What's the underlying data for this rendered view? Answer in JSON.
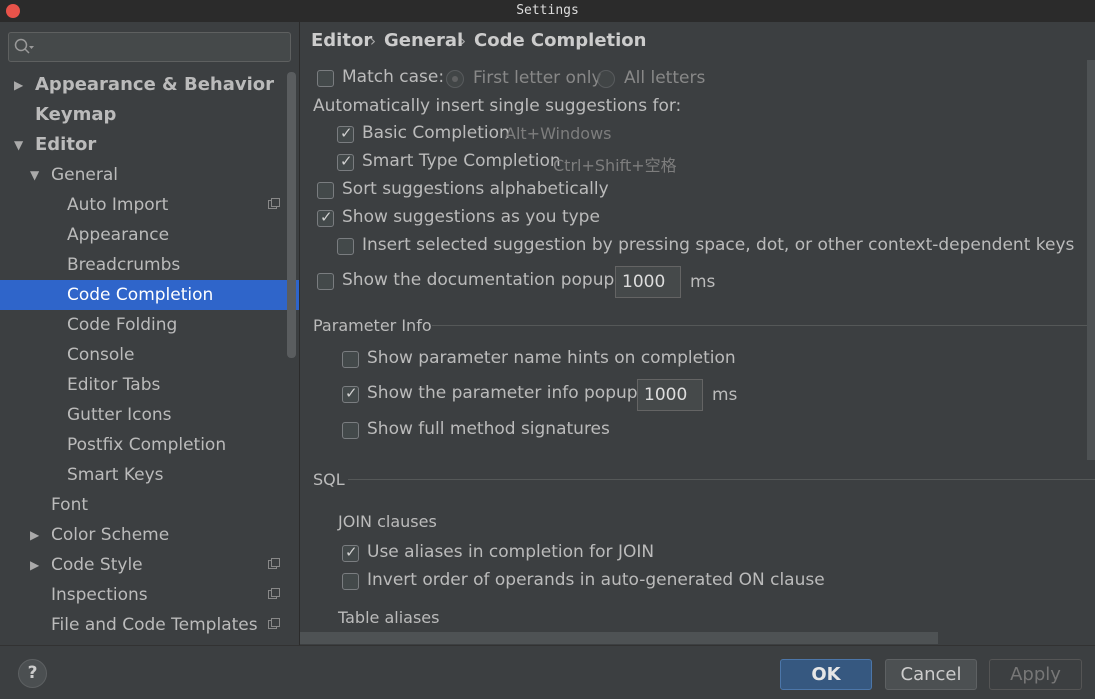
{
  "window": {
    "title": "Settings"
  },
  "sidebar": {
    "search_placeholder": "",
    "items": [
      {
        "label": "Appearance & Behavior",
        "arrow": "▶"
      },
      {
        "label": "Keymap"
      },
      {
        "label": "Editor",
        "arrow": "▼"
      },
      {
        "label": "General",
        "arrow": "▼"
      },
      {
        "label": "Auto Import"
      },
      {
        "label": "Appearance"
      },
      {
        "label": "Breadcrumbs"
      },
      {
        "label": "Code Completion"
      },
      {
        "label": "Code Folding"
      },
      {
        "label": "Console"
      },
      {
        "label": "Editor Tabs"
      },
      {
        "label": "Gutter Icons"
      },
      {
        "label": "Postfix Completion"
      },
      {
        "label": "Smart Keys"
      },
      {
        "label": "Font"
      },
      {
        "label": "Color Scheme",
        "arrow": "▶"
      },
      {
        "label": "Code Style",
        "arrow": "▶"
      },
      {
        "label": "Inspections"
      },
      {
        "label": "File and Code Templates"
      }
    ]
  },
  "breadcrumb": {
    "level1": "Editor",
    "level2": "General",
    "level3": "Code Completion",
    "separator": "›"
  },
  "main": {
    "match_case": "Match case:",
    "first_letter_only": "First letter only",
    "all_letters": "All letters",
    "auto_insert_heading": "Automatically insert single suggestions for:",
    "basic_completion": "Basic Completion",
    "basic_shortcut": "Alt+Windows",
    "smart_type_completion": "Smart Type Completion",
    "smart_shortcut": "Ctrl+Shift+空格",
    "sort_alpha": "Sort suggestions alphabetically",
    "show_as_you_type": "Show suggestions as you type",
    "insert_selected": "Insert selected suggestion by pressing space, dot, or other context-dependent keys",
    "doc_popup": "Show the documentation popup in",
    "doc_popup_value": "1000",
    "ms": "ms",
    "param_info_header": "Parameter Info",
    "param_name_hints": "Show parameter name hints on completion",
    "param_info_popup": "Show the parameter info popup in",
    "param_popup_value": "1000",
    "full_signatures": "Show full method signatures",
    "sql_header": "SQL",
    "join_clauses": "JOIN clauses",
    "use_aliases": "Use aliases in completion for JOIN",
    "invert_order": "Invert order of operands in auto-generated ON clause",
    "table_aliases": "Table aliases"
  },
  "buttons": {
    "help": "?",
    "ok": "OK",
    "cancel": "Cancel",
    "apply": "Apply"
  }
}
